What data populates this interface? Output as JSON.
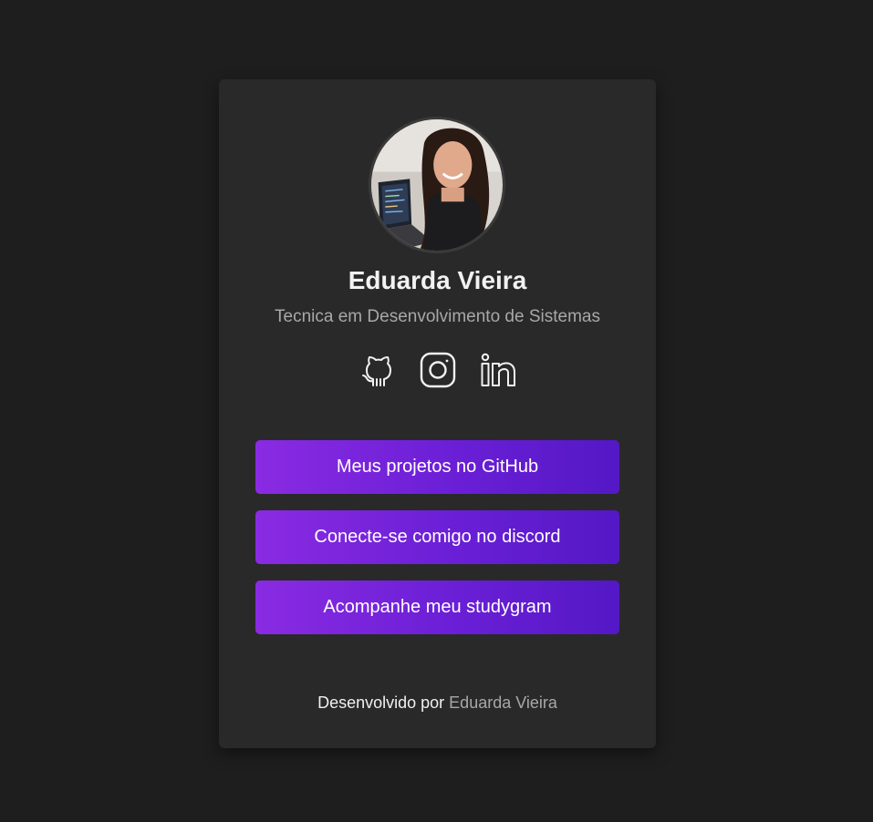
{
  "profile": {
    "name": "Eduarda Vieira",
    "role": "Tecnica em Desenvolvimento de Sistemas",
    "avatar_icon": "profile-photo"
  },
  "socials": [
    {
      "icon": "github-icon"
    },
    {
      "icon": "instagram-icon"
    },
    {
      "icon": "linkedin-icon"
    }
  ],
  "buttons": {
    "github": "Meus projetos no GitHub",
    "discord": "Conecte-se comigo no discord",
    "studygram": "Acompanhe meu studygram"
  },
  "footer": {
    "prefix": "Desenvolvido por ",
    "author": "Eduarda Vieira"
  },
  "colors": {
    "background": "#1e1e1e",
    "card": "#292929",
    "button_gradient_start": "#8a2be2",
    "button_gradient_end": "#5418c5",
    "muted_text": "#a8a8a8"
  }
}
